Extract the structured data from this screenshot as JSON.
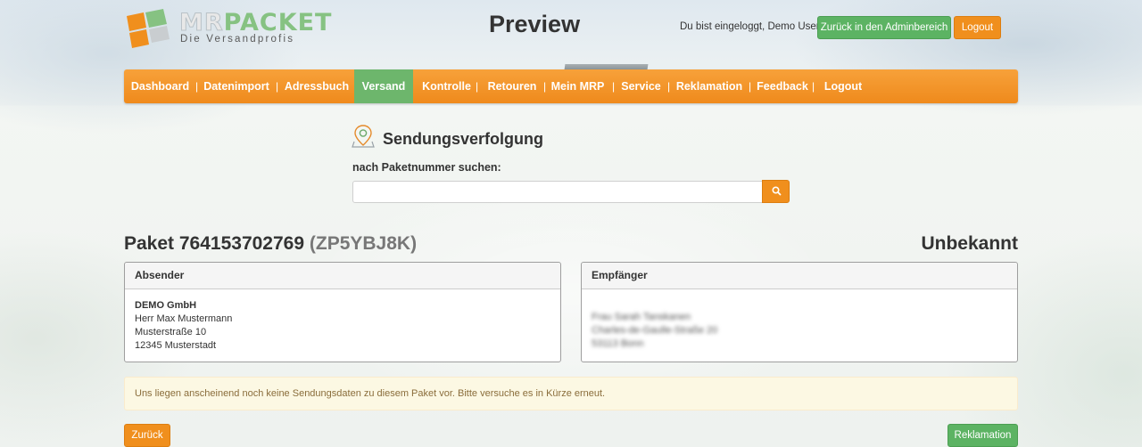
{
  "header": {
    "logo_main_left": "MR",
    "logo_main_right": "PACKET",
    "logo_sub": "Die Versandprofis",
    "page_title": "Preview",
    "login_info": "Du bist eingeloggt, Demo User",
    "admin_button": "Zurück in den Adminbereich",
    "logout_button": "Logout"
  },
  "nav": {
    "items": [
      {
        "label": "Dashboard"
      },
      {
        "label": "Datenimport"
      },
      {
        "label": "Adressbuch"
      },
      {
        "label": "Versand",
        "active": true
      },
      {
        "label": "Kontrolle"
      },
      {
        "label": "Retouren"
      },
      {
        "label": "Mein MRP"
      },
      {
        "label": "Service"
      },
      {
        "label": "Reklamation"
      },
      {
        "label": "Feedback"
      },
      {
        "label": "Logout"
      }
    ],
    "separator": "|"
  },
  "tracking": {
    "title": "Sendungsverfolgung",
    "search_label": "nach Paketnummer suchen:",
    "search_value": "",
    "search_placeholder": ""
  },
  "package": {
    "title_prefix": "Paket 764153702769",
    "code": "(ZP5YBJ8K)",
    "status": "Unbekannt"
  },
  "sender": {
    "heading": "Absender",
    "company": "DEMO GmbH",
    "name": "Herr Max Mustermann",
    "street": "Musterstraße 10",
    "city": "12345 Musterstadt"
  },
  "recipient": {
    "heading": "Empfänger",
    "name": "Frau Sarah Tanskanen",
    "street": "Charles-de-Gaulle-Straße 20",
    "city": "53113 Bonn"
  },
  "alert_text": "Uns liegen anscheinend noch keine Sendungsdaten zu diesem Paket vor. Bitte versuche es in Kürze erneut.",
  "footer": {
    "back_button": "Zurück",
    "claim_button": "Reklamation"
  },
  "colors": {
    "accent_orange": "#f08f1d",
    "accent_green": "#5cb363",
    "alert_bg": "#fcf8e3",
    "alert_text": "#8a6d3b"
  }
}
